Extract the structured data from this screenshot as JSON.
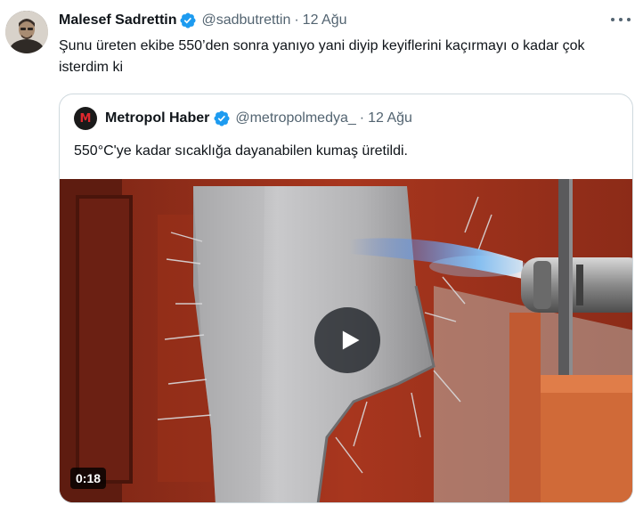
{
  "tweet": {
    "author_name": "Malesef Sadrettin",
    "author_handle": "@sadbutrettin",
    "separator": "·",
    "date": "12 Ağu",
    "text": "Şunu üreten ekibe 550’den sonra yanıyo yani diyip keyiflerini kaçırmayı o kadar çok isterdim ki",
    "avatar_icon": "profile-photo",
    "verified_icon": "verified-badge-icon",
    "more_icon": "more-options-icon"
  },
  "quoted_tweet": {
    "avatar_letter": "M",
    "author_name": "Metropol Haber",
    "author_handle": "@metropolmedya_",
    "separator": "·",
    "date": "12 Ağu",
    "text": "550°C'ye kadar sıcaklığa dayanabilen kumaş üretildi.",
    "media": {
      "type": "video",
      "duration": "0:18",
      "play_icon": "play-icon"
    }
  },
  "colors": {
    "text_primary": "#0f1419",
    "text_secondary": "#536471",
    "verified_blue": "#1d9bf0",
    "border": "#cfd9de",
    "logo_red": "#e0282e"
  }
}
